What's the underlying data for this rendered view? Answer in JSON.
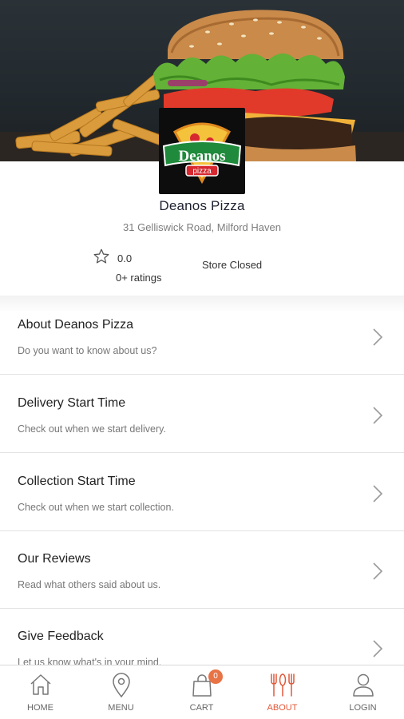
{
  "store": {
    "name": "Deanos Pizza",
    "address": "31 Gelliswick Road, Milford Haven",
    "rating": "0.0",
    "ratings_count": "0+ ratings",
    "status": "Store Closed",
    "logo_text": "Deanos",
    "logo_subtext": "pizza"
  },
  "menu": [
    {
      "title": "About Deanos Pizza",
      "subtitle": "Do you want to know about us?"
    },
    {
      "title": "Delivery Start Time",
      "subtitle": "Check out when we start delivery."
    },
    {
      "title": "Collection Start Time",
      "subtitle": "Check out when we start collection."
    },
    {
      "title": "Our Reviews",
      "subtitle": "Read what others said about us."
    },
    {
      "title": "Give Feedback",
      "subtitle": "Let us know what's in your mind."
    }
  ],
  "nav": {
    "home": "HOME",
    "menu": "MENU",
    "cart": "CART",
    "cart_count": "0",
    "about": "ABOUT",
    "login": "LOGIN"
  },
  "colors": {
    "accent": "#e1593a",
    "badge": "#e87345",
    "logo_green": "#1f8a3b",
    "logo_red": "#d7282f"
  },
  "icons": [
    "star-icon",
    "chevron-right-icon",
    "home-icon",
    "location-pin-icon",
    "shopping-bag-icon",
    "cutlery-icon",
    "user-icon"
  ]
}
